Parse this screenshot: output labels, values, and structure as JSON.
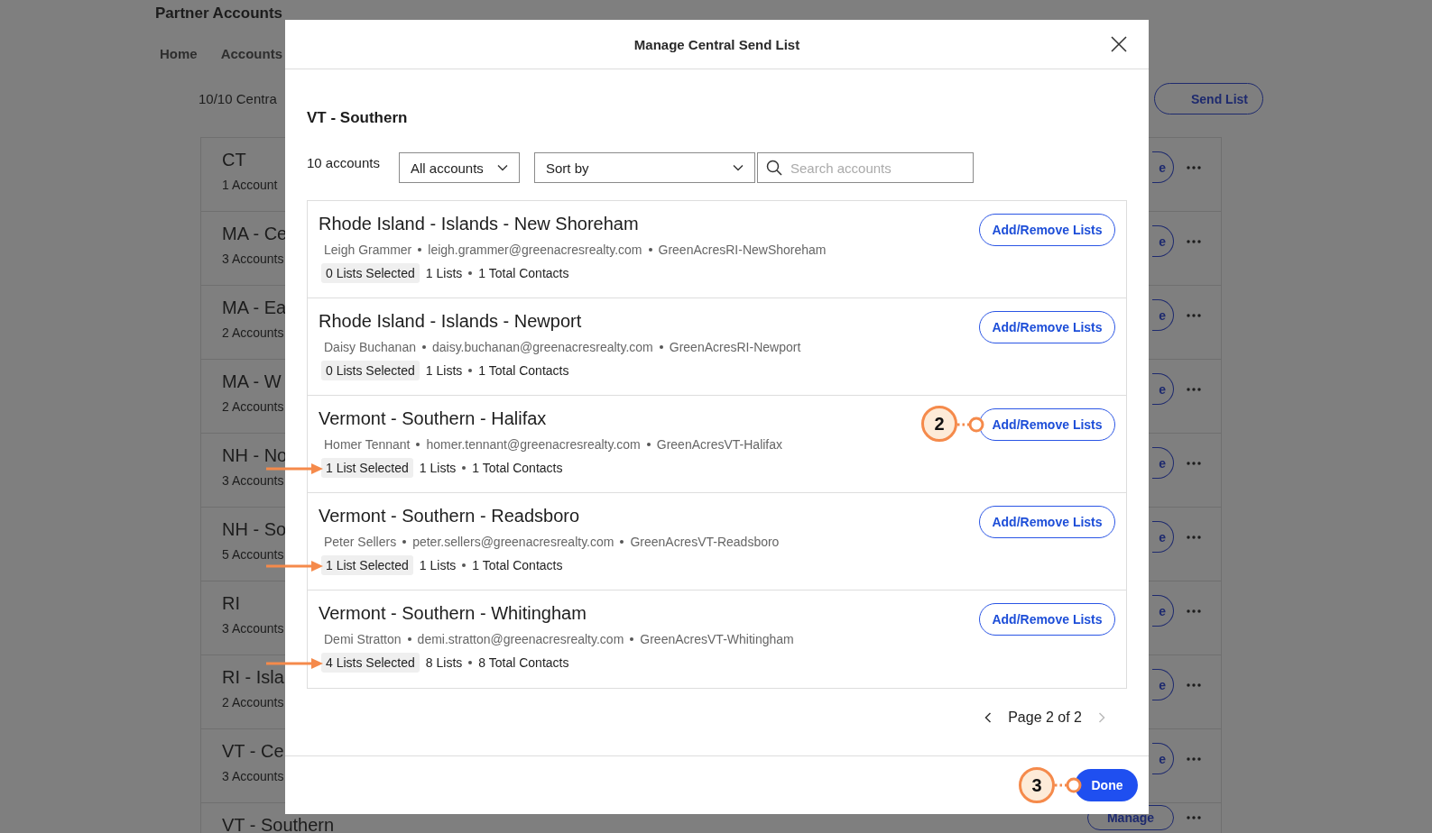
{
  "page": {
    "title": "Partner Accounts",
    "nav": [
      {
        "label": "Home"
      },
      {
        "label": "Accounts"
      }
    ],
    "summary": "10/10 Centra",
    "send_button": "Send List",
    "groups": [
      {
        "name": "CT",
        "count": "1 Account",
        "action": "e"
      },
      {
        "name": "MA - Ce",
        "count": "3 Accounts",
        "action": "e"
      },
      {
        "name": "MA - Ea",
        "count": "2 Accounts",
        "action": "e"
      },
      {
        "name": "MA - W",
        "count": "2 Accounts",
        "action": "e"
      },
      {
        "name": "NH - No",
        "count": "3 Accounts",
        "action": "e"
      },
      {
        "name": "NH - So",
        "count": "5 Accounts",
        "action": "e"
      },
      {
        "name": "RI",
        "count": "3 Accounts",
        "action": "e"
      },
      {
        "name": "RI - Isla",
        "count": "2 Accounts",
        "action": "e"
      },
      {
        "name": "VT - Ce",
        "count": "3 Accounts",
        "action": "e"
      },
      {
        "name": "VT - Southern",
        "action": "Manage"
      }
    ]
  },
  "modal": {
    "title": "Manage Central Send List",
    "group": "VT - Southern",
    "count": "10 accounts",
    "filter": {
      "value": "All accounts"
    },
    "sort": {
      "value": "Sort by"
    },
    "search": {
      "placeholder": "Search accounts"
    },
    "accounts": [
      {
        "name": "Rhode Island - Islands - New Shoreham",
        "contact": "Leigh Grammer",
        "email": "leigh.grammer@greenacresrealty.com",
        "handle": "GreenAcresRI-NewShoreham",
        "selected": "0 Lists Selected",
        "lists": "1 Lists",
        "contacts": "1 Total Contacts",
        "button": "Add/Remove Lists",
        "arrow": false
      },
      {
        "name": "Rhode Island - Islands - Newport",
        "contact": "Daisy Buchanan",
        "email": "daisy.buchanan@greenacresrealty.com",
        "handle": "GreenAcresRI-Newport",
        "selected": "0 Lists Selected",
        "lists": "1 Lists",
        "contacts": "1 Total Contacts",
        "button": "Add/Remove Lists",
        "arrow": false
      },
      {
        "name": "Vermont - Southern - Halifax",
        "contact": "Homer Tennant",
        "email": "homer.tennant@greenacresrealty.com",
        "handle": "GreenAcresVT-Halifax",
        "selected": "1 List Selected",
        "lists": "1 Lists",
        "contacts": "1 Total Contacts",
        "button": "Add/Remove Lists",
        "arrow": true,
        "callout": "2"
      },
      {
        "name": "Vermont - Southern - Readsboro",
        "contact": "Peter Sellers",
        "email": "peter.sellers@greenacresrealty.com",
        "handle": "GreenAcresVT-Readsboro",
        "selected": "1 List Selected",
        "lists": "1 Lists",
        "contacts": "1 Total Contacts",
        "button": "Add/Remove Lists",
        "arrow": true
      },
      {
        "name": "Vermont - Southern - Whitingham",
        "contact": "Demi Stratton",
        "email": "demi.stratton@greenacresrealty.com",
        "handle": "GreenAcresVT-Whitingham",
        "selected": "4 Lists Selected",
        "lists": "8 Lists",
        "contacts": "8 Total Contacts",
        "button": "Add/Remove Lists",
        "arrow": true
      }
    ],
    "pagination": {
      "label": "Page 2 of 2",
      "prev_disabled": false,
      "next_disabled": true
    },
    "done": {
      "label": "Done",
      "callout": "3"
    }
  }
}
